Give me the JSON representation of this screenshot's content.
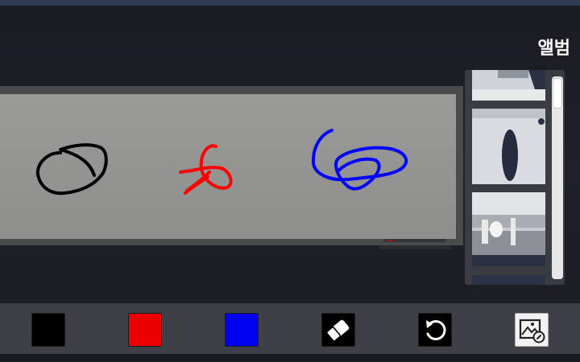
{
  "album": {
    "title": "앨범"
  },
  "toolbar": {
    "colors": [
      {
        "name": "black",
        "hex": "#000000"
      },
      {
        "name": "red",
        "hex": "#ee0000"
      },
      {
        "name": "blue",
        "hex": "#0000f0"
      }
    ],
    "tools": [
      "eraser-icon",
      "undo-icon",
      "album-icon"
    ]
  },
  "board": {
    "stroke_colors": [
      "#000000",
      "#ff0000",
      "#0000ff"
    ]
  }
}
